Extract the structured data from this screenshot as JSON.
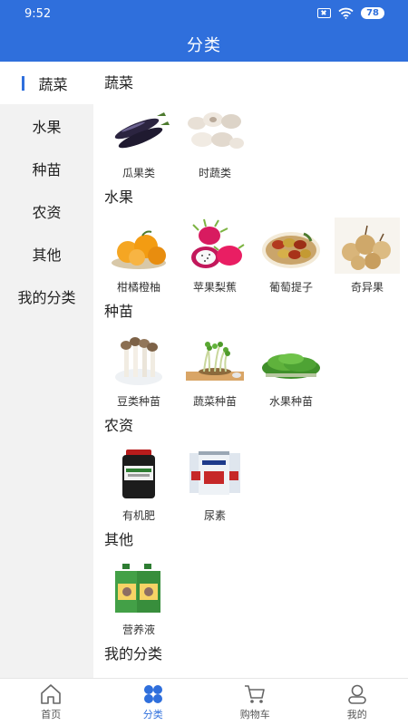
{
  "status": {
    "time": "9:52",
    "battery": "78"
  },
  "header": {
    "title": "分类"
  },
  "sidebar": {
    "items": [
      {
        "label": "蔬菜",
        "active": true
      },
      {
        "label": "水果"
      },
      {
        "label": "种苗"
      },
      {
        "label": "农资"
      },
      {
        "label": "其他"
      },
      {
        "label": "我的分类"
      }
    ]
  },
  "sections": [
    {
      "title": "蔬菜",
      "items": [
        {
          "label": "瓜果类",
          "icon": "eggplant-icon"
        },
        {
          "label": "时蔬类",
          "icon": "garlic-icon"
        }
      ]
    },
    {
      "title": "水果",
      "items": [
        {
          "label": "柑橘橙柚",
          "icon": "citrus-icon"
        },
        {
          "label": "苹果梨蕉",
          "icon": "dragonfruit-icon"
        },
        {
          "label": "葡萄提子",
          "icon": "jujube-icon"
        },
        {
          "label": "奇异果",
          "icon": "longan-icon"
        }
      ]
    },
    {
      "title": "种苗",
      "items": [
        {
          "label": "豆类种苗",
          "icon": "mushroom-sprout-icon"
        },
        {
          "label": "蔬菜种苗",
          "icon": "sprouts-board-icon"
        },
        {
          "label": "水果种苗",
          "icon": "microgreens-icon"
        }
      ]
    },
    {
      "title": "农资",
      "items": [
        {
          "label": "有机肥",
          "icon": "fertilizer-bucket-icon"
        },
        {
          "label": "尿素",
          "icon": "urea-cans-icon"
        }
      ]
    },
    {
      "title": "其他",
      "items": [
        {
          "label": "营养液",
          "icon": "nutrient-bottles-icon"
        }
      ]
    },
    {
      "title": "我的分类",
      "items": []
    }
  ],
  "tabbar": {
    "items": [
      {
        "label": "首页",
        "icon": "home-icon"
      },
      {
        "label": "分类",
        "icon": "category-icon",
        "active": true
      },
      {
        "label": "购物车",
        "icon": "cart-icon"
      },
      {
        "label": "我的",
        "icon": "user-icon"
      }
    ]
  },
  "colors": {
    "primary": "#2f6fdc",
    "sidebar_bg": "#f2f2f2"
  }
}
